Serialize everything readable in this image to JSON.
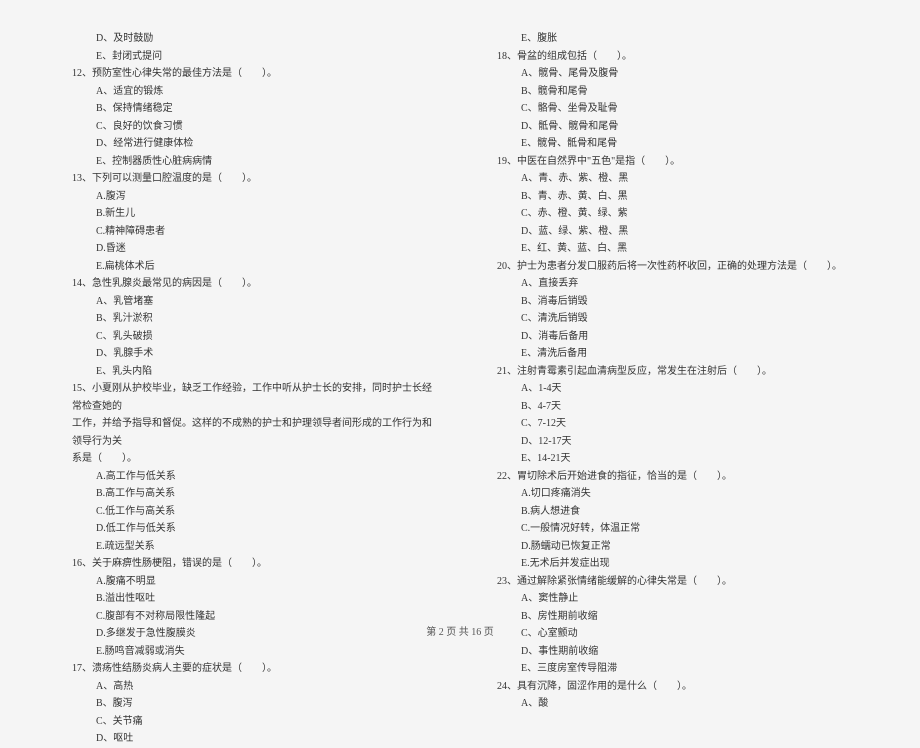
{
  "leftColumn": {
    "pre": [
      "D、及时鼓励",
      "E、封闭式提问"
    ],
    "q12": {
      "stem": "12、预防室性心律失常的最佳方法是（　　）。",
      "opts": [
        "A、适宜的锻炼",
        "B、保持情绪稳定",
        "C、良好的饮食习惯",
        "D、经常进行健康体检",
        "E、控制器质性心脏病病情"
      ]
    },
    "q13": {
      "stem": "13、下列可以测量口腔温度的是（　　）。",
      "opts": [
        "A.腹泻",
        "B.新生儿",
        "C.精神障碍患者",
        "D.昏迷",
        "E.扁桃体术后"
      ]
    },
    "q14": {
      "stem": "14、急性乳腺炎最常见的病因是（　　）。",
      "opts": [
        "A、乳管堵塞",
        "B、乳汁淤积",
        "C、乳头破损",
        "D、乳腺手术",
        "E、乳头内陷"
      ]
    },
    "q15": {
      "stem": "15、小夏刚从护校毕业，缺乏工作经验，工作中听从护士长的安排，同时护士长经常检查她的",
      "cont": [
        "工作，并给予指导和督促。这样的不成熟的护士和护理领导者间形成的工作行为和领导行为关",
        "系是（　　）。"
      ],
      "opts": [
        "A.高工作与低关系",
        "B.高工作与高关系",
        "C.低工作与高关系",
        "D.低工作与低关系",
        "E.疏远型关系"
      ]
    },
    "q16": {
      "stem": "16、关于麻痹性肠梗阻，错误的是（　　）。",
      "opts": [
        "A.腹痛不明显",
        "B.溢出性呕吐",
        "C.腹部有不对称局限性隆起",
        "D.多继发于急性腹膜炎",
        "E.肠鸣音减弱或消失"
      ]
    },
    "q17": {
      "stem": "17、溃疡性结肠炎病人主要的症状是（　　）。",
      "opts": [
        "A、高热",
        "B、腹泻",
        "C、关节痛",
        "D、呕吐"
      ]
    }
  },
  "rightColumn": {
    "pre": [
      "E、腹胀"
    ],
    "q18": {
      "stem": "18、骨盆的组成包括（　　）。",
      "opts": [
        "A、髋骨、尾骨及腹骨",
        "B、髋骨和尾骨",
        "C、骼骨、坐骨及耻骨",
        "D、骶骨、髋骨和尾骨",
        "E、髋骨、骶骨和尾骨"
      ]
    },
    "q19": {
      "stem": "19、中医在自然界中\"五色\"是指（　　）。",
      "opts": [
        "A、青、赤、紫、橙、黑",
        "B、青、赤、黄、白、黑",
        "C、赤、橙、黄、绿、紫",
        "D、蓝、绿、紫、橙、黑",
        "E、红、黄、蓝、白、黑"
      ]
    },
    "q20": {
      "stem": "20、护士为患者分发口服药后将一次性药杯收回，正确的处理方法是（　　）。",
      "opts": [
        "A、直接丢弃",
        "B、消毒后销毁",
        "C、清洗后销毁",
        "D、消毒后备用",
        "E、清洗后备用"
      ]
    },
    "q21": {
      "stem": "21、注射青霉素引起血清病型反应，常发生在注射后（　　）。",
      "opts": [
        "A、1-4天",
        "B、4-7天",
        "C、7-12天",
        "D、12-17天",
        "E、14-21天"
      ]
    },
    "q22": {
      "stem": "22、胃切除术后开始进食的指征，恰当的是（　　）。",
      "opts": [
        "A.切口疼痛消失",
        "B.病人想进食",
        "C.一般情况好转，体温正常",
        "D.肠蠕动已恢复正常",
        "E.无术后并发症出现"
      ]
    },
    "q23": {
      "stem": "23、通过解除紧张情绪能缓解的心律失常是（　　）。",
      "opts": [
        "A、窦性静止",
        "B、房性期前收缩",
        "C、心室颤动",
        "D、事性期前收缩",
        "E、三度房室传导阻滞"
      ]
    },
    "q24": {
      "stem": "24、具有沉降，固涩作用的是什么（　　）。",
      "opts": [
        "A、酸"
      ]
    }
  },
  "footer": "第 2 页 共 16 页"
}
